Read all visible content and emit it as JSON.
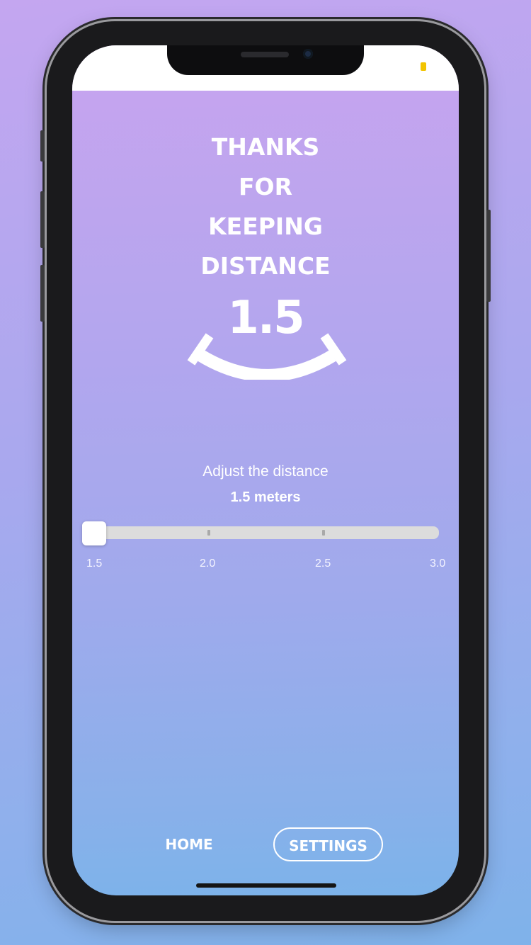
{
  "screen": {
    "title_lines": [
      "THANKS",
      "FOR",
      "KEEPING",
      "DISTANCE"
    ],
    "distance_value": "1.5",
    "smile_icon": "smile-arc-icon"
  },
  "adjust": {
    "label": "Adjust the distance",
    "value_text": "1.5 meters",
    "slider": {
      "min": 1.5,
      "max": 3.0,
      "step": 0.5,
      "value": 1.5,
      "tick_labels": [
        "1.5",
        "2.0",
        "2.5",
        "3.0"
      ]
    }
  },
  "nav": {
    "home_label": "HOME",
    "settings_label": "SETTINGS",
    "active": "SETTINGS"
  },
  "colors": {
    "status_indicator": "#f2c400",
    "slider_track": "#dcdcdc",
    "text": "#ffffff"
  }
}
